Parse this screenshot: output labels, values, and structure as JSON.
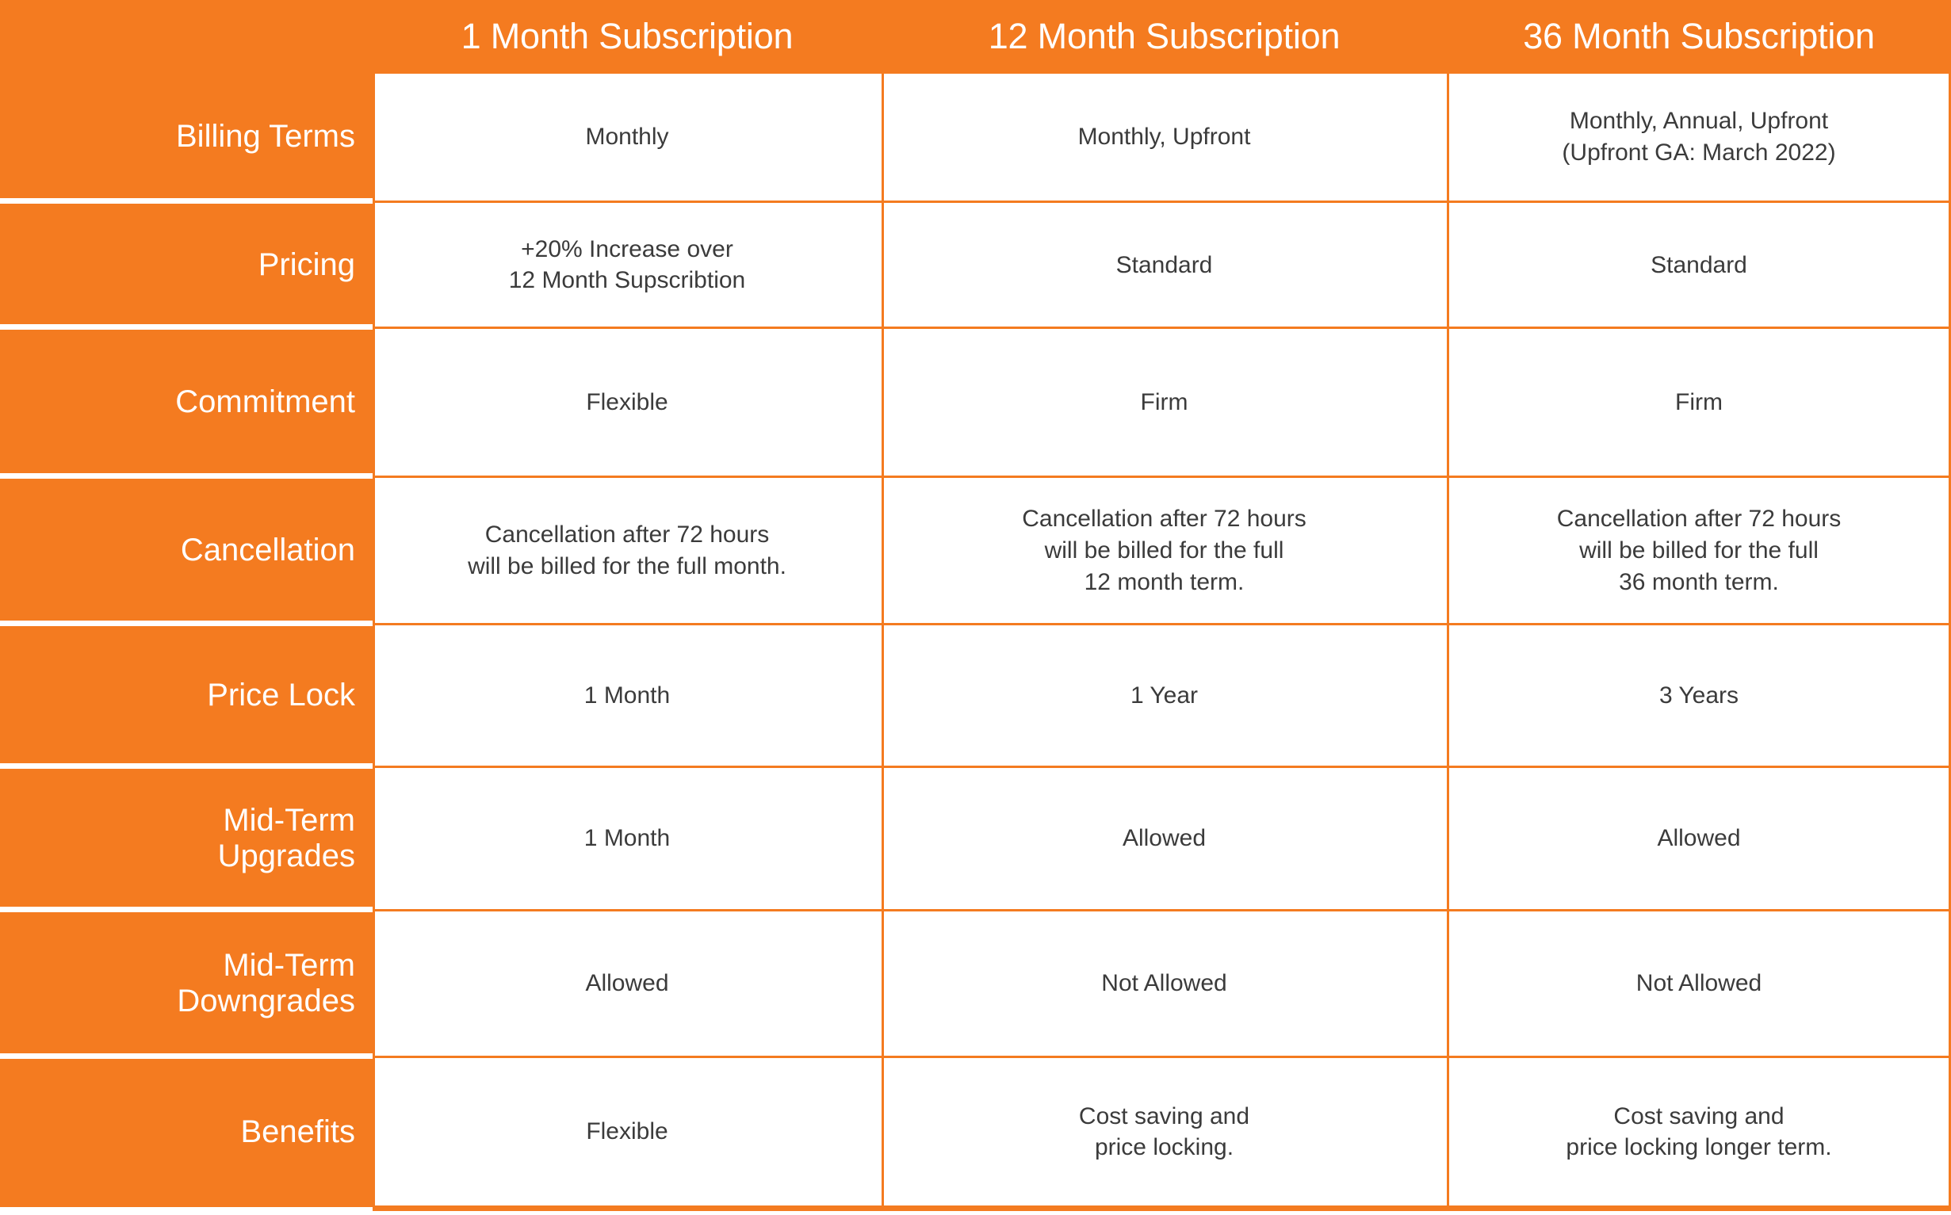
{
  "table": {
    "accent_color": "#F47B20",
    "header_text_color": "#FFFFFF",
    "body_text_color": "#3B3B3B",
    "corner_label": "",
    "columns": [
      {
        "header": "1 Month Subscription"
      },
      {
        "header": "12 Month Subscription"
      },
      {
        "header": "36 Month Subscription"
      }
    ],
    "rows": [
      {
        "label": "Billing Terms",
        "label_lines": [
          "Billing Terms"
        ],
        "cells": [
          {
            "lines": [
              "Monthly"
            ]
          },
          {
            "lines": [
              "Monthly, Upfront"
            ]
          },
          {
            "lines": [
              "Monthly, Annual, Upfront",
              "(Upfront GA: March 2022)"
            ]
          }
        ]
      },
      {
        "label": "Pricing",
        "label_lines": [
          "Pricing"
        ],
        "cells": [
          {
            "lines": [
              "+20% Increase over",
              "12 Month Supscribtion"
            ]
          },
          {
            "lines": [
              "Standard"
            ]
          },
          {
            "lines": [
              "Standard"
            ]
          }
        ]
      },
      {
        "label": "Commitment",
        "label_lines": [
          "Commitment"
        ],
        "cells": [
          {
            "lines": [
              "Flexible"
            ]
          },
          {
            "lines": [
              "Firm"
            ]
          },
          {
            "lines": [
              "Firm"
            ]
          }
        ]
      },
      {
        "label": "Cancellation",
        "label_lines": [
          "Cancellation"
        ],
        "cells": [
          {
            "lines": [
              "Cancellation after 72 hours",
              "will be billed for the full month."
            ]
          },
          {
            "lines": [
              "Cancellation after 72 hours",
              "will be billed for the full",
              "12 month term."
            ]
          },
          {
            "lines": [
              "Cancellation after 72 hours",
              "will be billed for the full",
              "36 month term."
            ]
          }
        ]
      },
      {
        "label": "Price Lock",
        "label_lines": [
          "Price Lock"
        ],
        "cells": [
          {
            "lines": [
              "1 Month"
            ]
          },
          {
            "lines": [
              "1 Year"
            ]
          },
          {
            "lines": [
              "3 Years"
            ]
          }
        ]
      },
      {
        "label": "Mid-Term Upgrades",
        "label_lines": [
          "Mid-Term",
          "Upgrades"
        ],
        "cells": [
          {
            "lines": [
              "1 Month"
            ]
          },
          {
            "lines": [
              "Allowed"
            ]
          },
          {
            "lines": [
              "Allowed"
            ]
          }
        ]
      },
      {
        "label": "Mid-Term Downgrades",
        "label_lines": [
          "Mid-Term",
          "Downgrades"
        ],
        "cells": [
          {
            "lines": [
              "Allowed"
            ]
          },
          {
            "lines": [
              "Not Allowed"
            ]
          },
          {
            "lines": [
              "Not Allowed"
            ]
          }
        ]
      },
      {
        "label": "Benefits",
        "label_lines": [
          "Benefits"
        ],
        "cells": [
          {
            "lines": [
              "Flexible"
            ]
          },
          {
            "lines": [
              "Cost saving and",
              "price locking."
            ]
          },
          {
            "lines": [
              "Cost saving and",
              "price locking longer term."
            ]
          }
        ]
      }
    ]
  }
}
